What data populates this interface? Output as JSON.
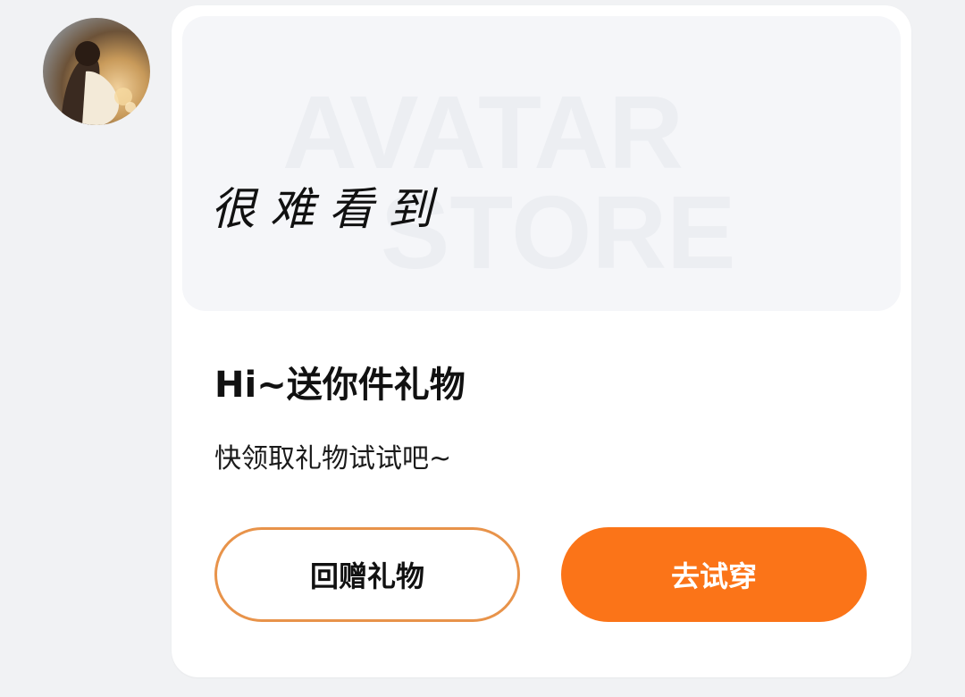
{
  "sender": {
    "avatar_alt": ""
  },
  "banner": {
    "wordmark_line1": "AVATAR",
    "wordmark_line2": "STORE",
    "caption": "很难看到"
  },
  "message": {
    "title": "Hi~送你件礼物",
    "subtitle": "快领取礼物试试吧~"
  },
  "actions": {
    "return_gift_label": "回赠礼物",
    "try_on_label": "去试穿"
  },
  "colors": {
    "accent": "#fb7418",
    "accent_border": "#e8934a",
    "card_bg": "#ffffff",
    "banner_bg": "#f5f6f9",
    "page_bg": "#f1f2f4"
  }
}
